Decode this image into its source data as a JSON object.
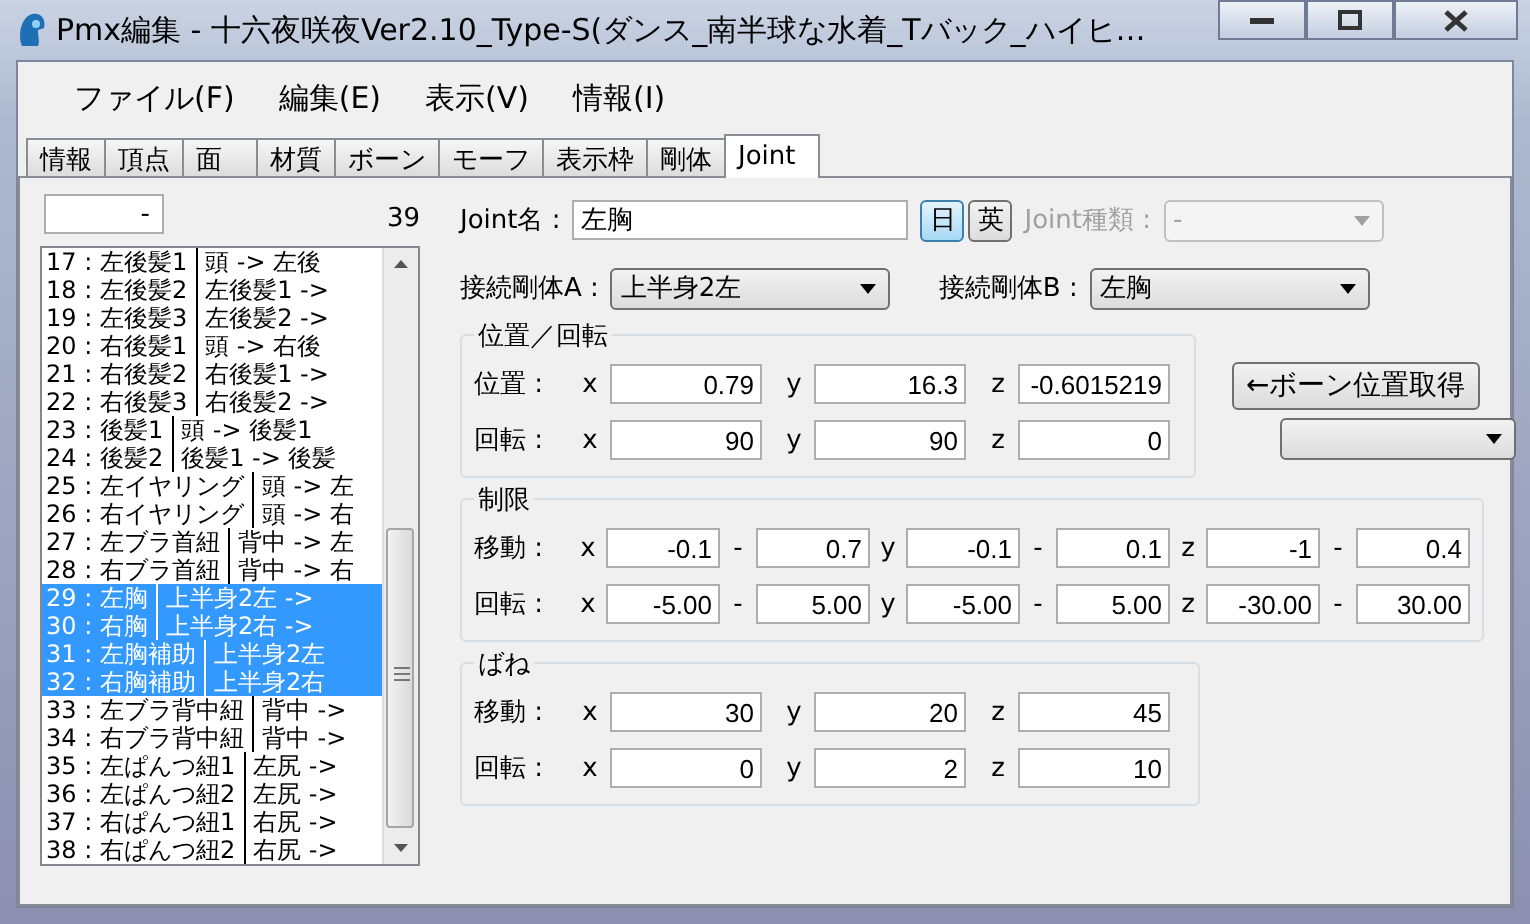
{
  "window": {
    "title": "Pmx編集 - 十六夜咲夜Ver2.10_Type-S(ダンス_南半球な水着_Tバック_ハイヒ…"
  },
  "menu": [
    "ファイル(F)",
    "編集(E)",
    "表示(V)",
    "情報(I)"
  ],
  "tabs": [
    {
      "label": "情報",
      "selected": false
    },
    {
      "label": "頂点",
      "selected": false
    },
    {
      "label": "面",
      "selected": false
    },
    {
      "label": "材質",
      "selected": false
    },
    {
      "label": "ボーン",
      "selected": false
    },
    {
      "label": "モーフ",
      "selected": false
    },
    {
      "label": "表示枠",
      "selected": false
    },
    {
      "label": "剛体",
      "selected": false
    },
    {
      "label": "Joint",
      "selected": true
    }
  ],
  "joint_list": {
    "filter_value": "-",
    "count": "39",
    "rows": [
      {
        "name": "17 : 左後髪1",
        "bones": "頭 -> 左後",
        "selected": false
      },
      {
        "name": "18 : 左後髪2",
        "bones": "左後髪1 ->",
        "selected": false
      },
      {
        "name": "19 : 左後髪3",
        "bones": "左後髪2 ->",
        "selected": false
      },
      {
        "name": "20 : 右後髪1",
        "bones": "頭 -> 右後",
        "selected": false
      },
      {
        "name": "21 : 右後髪2",
        "bones": "右後髪1 ->",
        "selected": false
      },
      {
        "name": "22 : 右後髪3",
        "bones": "右後髪2 ->",
        "selected": false
      },
      {
        "name": "23 : 後髪1",
        "bones": "頭 -> 後髪1",
        "selected": false
      },
      {
        "name": "24 : 後髪2",
        "bones": "後髪1 -> 後髪",
        "selected": false
      },
      {
        "name": "25 : 左イヤリング",
        "bones": "頭 -> 左",
        "selected": false
      },
      {
        "name": "26 : 右イヤリング",
        "bones": "頭 -> 右",
        "selected": false
      },
      {
        "name": "27 : 左ブラ首紐",
        "bones": "背中 -> 左",
        "selected": false
      },
      {
        "name": "28 : 右ブラ首紐",
        "bones": "背中 -> 右",
        "selected": false
      },
      {
        "name": "29 : 左胸",
        "bones": "上半身2左 ->",
        "selected": true
      },
      {
        "name": "30 : 右胸",
        "bones": "上半身2右 ->",
        "selected": true
      },
      {
        "name": "31 : 左胸補助",
        "bones": "上半身2左",
        "selected": true
      },
      {
        "name": "32 : 右胸補助",
        "bones": "上半身2右",
        "selected": true
      },
      {
        "name": "33 : 左ブラ背中紐",
        "bones": "背中 ->",
        "selected": false
      },
      {
        "name": "34 : 右ブラ背中紐",
        "bones": "背中 ->",
        "selected": false
      },
      {
        "name": "35 : 左ぱんつ紐1",
        "bones": "左尻 ->",
        "selected": false
      },
      {
        "name": "36 : 左ぱんつ紐2",
        "bones": "左尻 ->",
        "selected": false
      },
      {
        "name": "37 : 右ぱんつ紐1",
        "bones": "右尻 ->",
        "selected": false
      },
      {
        "name": "38 : 右ぱんつ紐2",
        "bones": "右尻 ->",
        "selected": false
      }
    ]
  },
  "joint_form": {
    "name_label": "Joint名 :",
    "name_value": "左胸",
    "lang_buttons": [
      {
        "label": "日",
        "selected": true
      },
      {
        "label": "英",
        "selected": false
      }
    ],
    "type_label": "Joint種類 :",
    "type_value": "-",
    "type_disabled": true,
    "rigid_a_label": "接続剛体A :",
    "rigid_a_value": "上半身2左",
    "rigid_b_label": "接続剛体B :",
    "rigid_b_value": "左胸",
    "bone_position_button": "←ボーン位置取得"
  },
  "position_rotation": {
    "title": "位置／回転",
    "rows": [
      {
        "label": "位置 :",
        "fields": [
          {
            "axis": "x",
            "value": "0.79"
          },
          {
            "axis": "y",
            "value": "16.3"
          },
          {
            "axis": "z",
            "value": "-0.6015219"
          }
        ]
      },
      {
        "label": "回転 :",
        "fields": [
          {
            "axis": "x",
            "value": "90"
          },
          {
            "axis": "y",
            "value": "90"
          },
          {
            "axis": "z",
            "value": "0"
          }
        ]
      }
    ]
  },
  "limits": {
    "title": "制限",
    "rows": [
      {
        "label": "移動 :",
        "fields": [
          {
            "axis": "x",
            "min": "-0.1",
            "dash": "-",
            "max": "0.7"
          },
          {
            "axis": "y",
            "min": "-0.1",
            "dash": "-",
            "max": "0.1"
          },
          {
            "axis": "z",
            "min": "-1",
            "dash": "-",
            "max": "0.4"
          }
        ]
      },
      {
        "label": "回転 :",
        "fields": [
          {
            "axis": "x",
            "min": "-5.00",
            "dash": "-",
            "max": "5.00"
          },
          {
            "axis": "y",
            "min": "-5.00",
            "dash": "-",
            "max": "5.00"
          },
          {
            "axis": "z",
            "min": "-30.00",
            "dash": "-",
            "max": "30.00"
          }
        ]
      }
    ]
  },
  "spring": {
    "title": "ばね",
    "rows": [
      {
        "label": "移動 :",
        "fields": [
          {
            "axis": "x",
            "value": "30"
          },
          {
            "axis": "y",
            "value": "20"
          },
          {
            "axis": "z",
            "value": "45"
          }
        ]
      },
      {
        "label": "回転 :",
        "fields": [
          {
            "axis": "x",
            "value": "0"
          },
          {
            "axis": "y",
            "value": "2"
          },
          {
            "axis": "z",
            "value": "10"
          }
        ]
      }
    ]
  }
}
